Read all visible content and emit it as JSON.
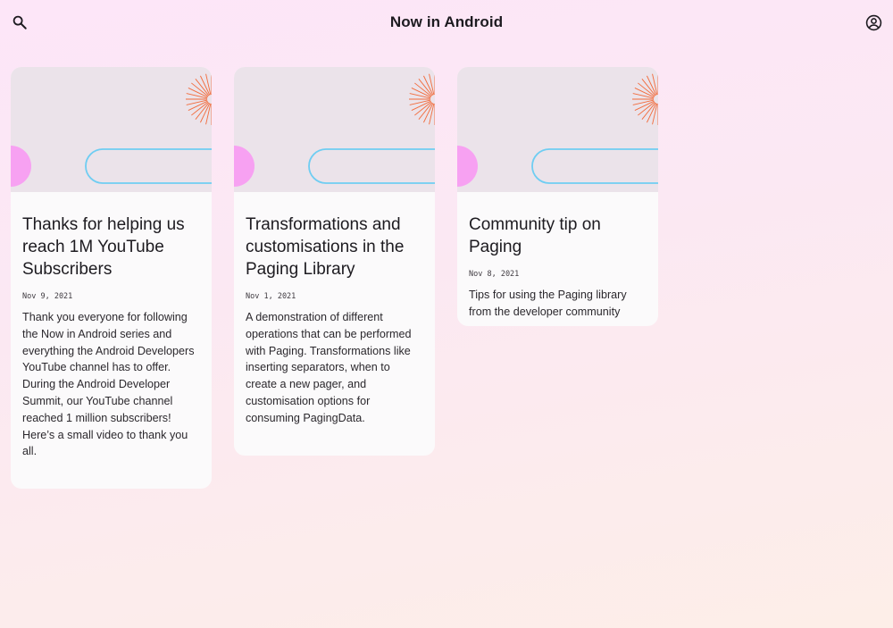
{
  "app": {
    "title": "Now in Android"
  },
  "icons": {
    "search": "search-icon",
    "account": "account-circle-icon"
  },
  "colors": {
    "accent_pink": "#f7a1f2",
    "accent_blue": "#6fcdf2",
    "accent_orange": "#f26b3c",
    "header_bg": "#ebe3ea",
    "card_bg": "#fbfafb"
  },
  "cards": [
    {
      "title": "Thanks for helping us reach 1M YouTube Subscribers",
      "date": "Nov 9, 2021",
      "description": "Thank you everyone for following the Now in Android series and everything the Android Developers YouTube channel has to offer. During the Android Developer Summit, our YouTube channel reached 1 million subscribers! Here’s a small video to thank you all."
    },
    {
      "title": "Transformations and customisations in the Paging Library",
      "date": "Nov 1, 2021",
      "description": "A demonstration of different operations that can be performed with Paging. Transformations like inserting separators, when to create a new pager, and customisation options for consuming PagingData."
    },
    {
      "title": "Community tip on Paging",
      "date": "Nov 8, 2021",
      "description": "Tips for using the Paging library from the developer community"
    }
  ]
}
